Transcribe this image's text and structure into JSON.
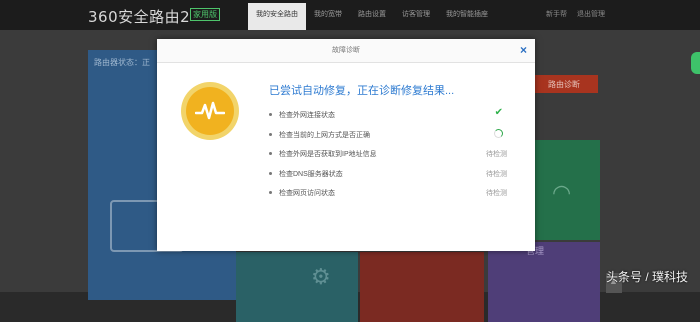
{
  "header": {
    "logo": "360安全路由2",
    "edition": "家用版",
    "tabs": [
      "我的安全路由",
      "我的宽带",
      "路由设置",
      "访客管理",
      "我的智能插座"
    ],
    "right_links": [
      "新手帮",
      "退出管理"
    ]
  },
  "dashboard": {
    "blue_tile_label": "路由器状态：正",
    "orange_tile_label": "路由诊断",
    "purple_tile_label": "管理"
  },
  "dialog": {
    "title": "故障诊断",
    "close": "×",
    "heading": "已尝试自动修复，正在诊断修复结果...",
    "checks": [
      {
        "label": "检查外网连接状态",
        "state": "done"
      },
      {
        "label": "检查当前的上网方式是否正确",
        "state": "running"
      },
      {
        "label": "检查外网是否获取到IP地址信息",
        "state": "pending",
        "status_text": "待检测"
      },
      {
        "label": "检查DNS服务器状态",
        "state": "pending",
        "status_text": "待检测"
      },
      {
        "label": "检查网页访问状态",
        "state": "pending",
        "status_text": "待检测"
      }
    ]
  },
  "watermark": "头条号 / 璞科技",
  "icons": {
    "close": "close-icon",
    "check": "checkmark-icon",
    "loading": "spinner-icon",
    "diagnosis": "diagnosis-pulse-icon"
  },
  "colors": {
    "accent_blue": "#2e7bd1",
    "success_green": "#2fb24b",
    "icon_yellow": "#f1b21f"
  }
}
